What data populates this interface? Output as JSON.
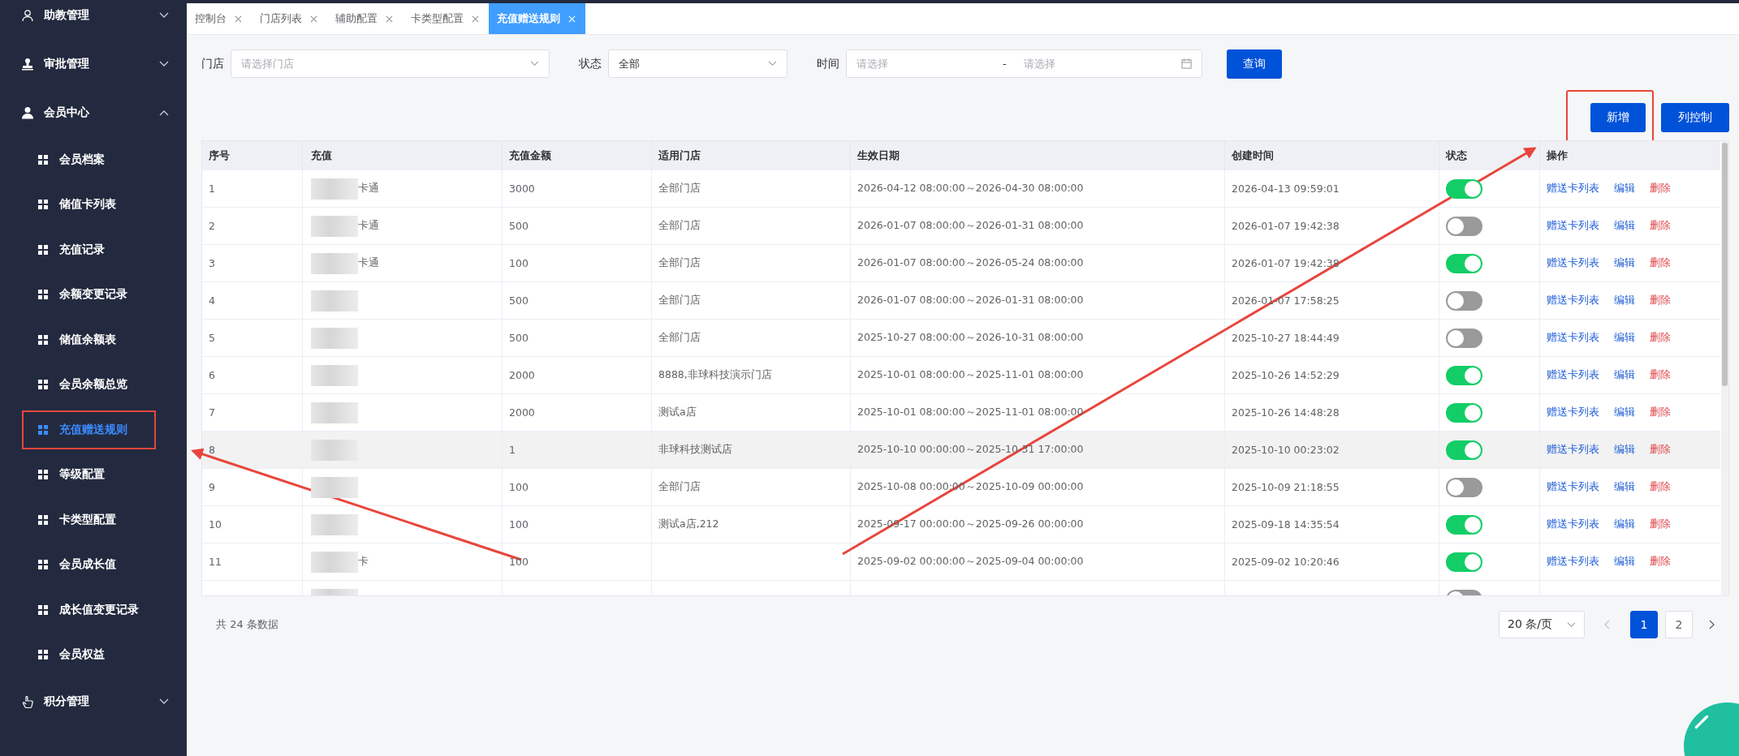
{
  "sidebar": {
    "groups": [
      {
        "label": "助教管理",
        "kind": "user",
        "expanded": false
      },
      {
        "label": "审批管理",
        "kind": "stamp",
        "expanded": false
      },
      {
        "label": "会员中心",
        "kind": "person",
        "expanded": true,
        "children": [
          {
            "label": "会员档案",
            "selected": false,
            "highlighted": false
          },
          {
            "label": "储值卡列表",
            "selected": false,
            "highlighted": false
          },
          {
            "label": "充值记录",
            "selected": false,
            "highlighted": false
          },
          {
            "label": "余额变更记录",
            "selected": false,
            "highlighted": false
          },
          {
            "label": "储值余额表",
            "selected": false,
            "highlighted": false
          },
          {
            "label": "会员余额总览",
            "selected": false,
            "highlighted": false
          },
          {
            "label": "充值赠送规则",
            "selected": true,
            "highlighted": true
          },
          {
            "label": "等级配置",
            "selected": false,
            "highlighted": false
          },
          {
            "label": "卡类型配置",
            "selected": false,
            "highlighted": false
          },
          {
            "label": "会员成长值",
            "selected": false,
            "highlighted": false
          },
          {
            "label": "成长值变更记录",
            "selected": false,
            "highlighted": false
          },
          {
            "label": "会员权益",
            "selected": false,
            "highlighted": false
          }
        ]
      },
      {
        "label": "积分管理",
        "kind": "hand",
        "expanded": false
      }
    ]
  },
  "tabs": [
    {
      "label": "控制台",
      "selected": false
    },
    {
      "label": "门店列表",
      "selected": false
    },
    {
      "label": "辅助配置",
      "selected": false
    },
    {
      "label": "卡类型配置",
      "selected": false
    },
    {
      "label": "充值赠送规则",
      "selected": true
    }
  ],
  "filters": {
    "store": {
      "label": "门店",
      "placeholder": "请选择门店"
    },
    "status": {
      "label": "状态",
      "value": "全部"
    },
    "time": {
      "label": "时间",
      "start_placeholder": "请选择",
      "separator": "-",
      "end_placeholder": "请选择"
    },
    "query_button": "查询"
  },
  "actions": [
    {
      "label": "新增",
      "highlighted": true
    },
    {
      "label": "列控制",
      "highlighted": false
    }
  ],
  "table": {
    "columns": [
      "序号",
      "充值",
      "充值金额",
      "适用门店",
      "生效日期",
      "创建时间",
      "状态",
      "操作"
    ],
    "rows": [
      {
        "index": "1",
        "name": "卡通",
        "amount": "3000",
        "stores": "全部门店",
        "period": "2026-04-12 08:00:00～2026-04-30 08:00:00",
        "created": "2026-04-13 09:59:01",
        "on": true,
        "highlighted": false,
        "actions": [
          "赠送卡列表",
          "编辑",
          "删除"
        ]
      },
      {
        "index": "2",
        "name": "卡通",
        "amount": "500",
        "stores": "全部门店",
        "period": "2026-01-07 08:00:00～2026-01-31 08:00:00",
        "created": "2026-01-07 19:42:38",
        "on": false,
        "highlighted": false,
        "actions": [
          "赠送卡列表",
          "编辑",
          "删除"
        ]
      },
      {
        "index": "3",
        "name": "卡通",
        "amount": "100",
        "stores": "全部门店",
        "period": "2026-01-07 08:00:00～2026-05-24 08:00:00",
        "created": "2026-01-07 19:42:38",
        "on": true,
        "highlighted": false,
        "actions": [
          "赠送卡列表",
          "编辑",
          "删除"
        ]
      },
      {
        "index": "4",
        "amount": "500",
        "stores": "全部门店",
        "period": "2026-01-07 08:00:00～2026-01-31 08:00:00",
        "created": "2026-01-07 17:58:25",
        "on": false,
        "highlighted": false,
        "actions": [
          "赠送卡列表",
          "编辑",
          "删除"
        ]
      },
      {
        "index": "5",
        "amount": "500",
        "stores": "全部门店",
        "period": "2025-10-27 08:00:00～2026-10-31 08:00:00",
        "created": "2025-10-27 18:44:49",
        "on": false,
        "highlighted": false,
        "actions": [
          "赠送卡列表",
          "编辑",
          "删除"
        ]
      },
      {
        "index": "6",
        "amount": "2000",
        "stores": "8888,非球科技演示门店",
        "period": "2025-10-01 08:00:00～2025-11-01 08:00:00",
        "created": "2025-10-26 14:52:29",
        "on": true,
        "highlighted": false,
        "actions": [
          "赠送卡列表",
          "编辑",
          "删除"
        ]
      },
      {
        "index": "7",
        "amount": "2000",
        "stores": "测试a店",
        "period": "2025-10-01 08:00:00～2025-11-01 08:00:00",
        "created": "2025-10-26 14:48:28",
        "on": true,
        "highlighted": false,
        "actions": [
          "赠送卡列表",
          "编辑",
          "删除"
        ]
      },
      {
        "index": "8",
        "amount": "1",
        "stores": "非球科技测试店",
        "period": "2025-10-10 00:00:00～2025-10-31 17:00:00",
        "created": "2025-10-10 00:23:02",
        "on": true,
        "highlighted": true,
        "actions": [
          "赠送卡列表",
          "编辑",
          "删除"
        ]
      },
      {
        "index": "9",
        "amount": "100",
        "stores": "全部门店",
        "period": "2025-10-08 00:00:00～2025-10-09 00:00:00",
        "created": "2025-10-09 21:18:55",
        "on": false,
        "highlighted": false,
        "actions": [
          "赠送卡列表",
          "编辑",
          "删除"
        ]
      },
      {
        "index": "10",
        "amount": "100",
        "stores": "测试a店,212",
        "period": "2025-09-17 00:00:00～2025-09-26 00:00:00",
        "created": "2025-09-18 14:35:54",
        "on": true,
        "highlighted": false,
        "actions": [
          "赠送卡列表",
          "编辑",
          "删除"
        ]
      },
      {
        "index": "11",
        "name": "卡",
        "amount": "100",
        "period": "2025-09-02 00:00:00～2025-09-04 00:00:00",
        "created": "2025-09-02 10:20:46",
        "on": true,
        "highlighted": false,
        "actions": [
          "赠送卡列表",
          "编辑",
          "删除"
        ]
      },
      {
        "on": false,
        "highlighted": false
      }
    ]
  },
  "footer": {
    "total": "共 24 条数据",
    "page_size": "20 条/页",
    "pages": [
      {
        "label": "1",
        "selected": true
      },
      {
        "label": "2",
        "selected": false
      }
    ]
  }
}
